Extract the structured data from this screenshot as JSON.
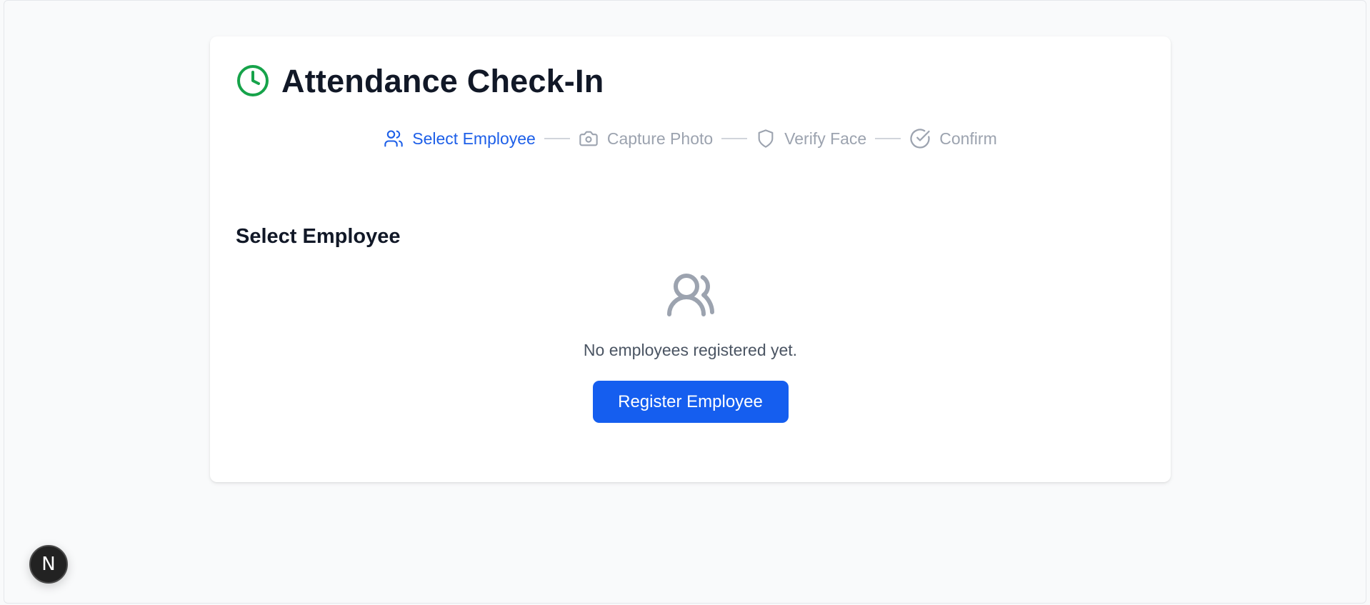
{
  "header": {
    "title": "Attendance Check-In",
    "icon": "clock-icon",
    "accent_color": "#16a34a"
  },
  "stepper": {
    "active_color": "#1d5fe8",
    "inactive_color": "#9ca3af",
    "steps": [
      {
        "label": "Select Employee",
        "icon": "users-icon",
        "state": "active"
      },
      {
        "label": "Capture Photo",
        "icon": "camera-icon",
        "state": "inactive"
      },
      {
        "label": "Verify Face",
        "icon": "shield-icon",
        "state": "inactive"
      },
      {
        "label": "Confirm",
        "icon": "check-circle-icon",
        "state": "inactive"
      }
    ]
  },
  "section": {
    "title": "Select Employee"
  },
  "empty_state": {
    "icon": "users-icon",
    "message": "No employees registered yet.",
    "button_label": "Register Employee",
    "button_color": "#155eef"
  },
  "dev_badge": {
    "letter": "N"
  }
}
